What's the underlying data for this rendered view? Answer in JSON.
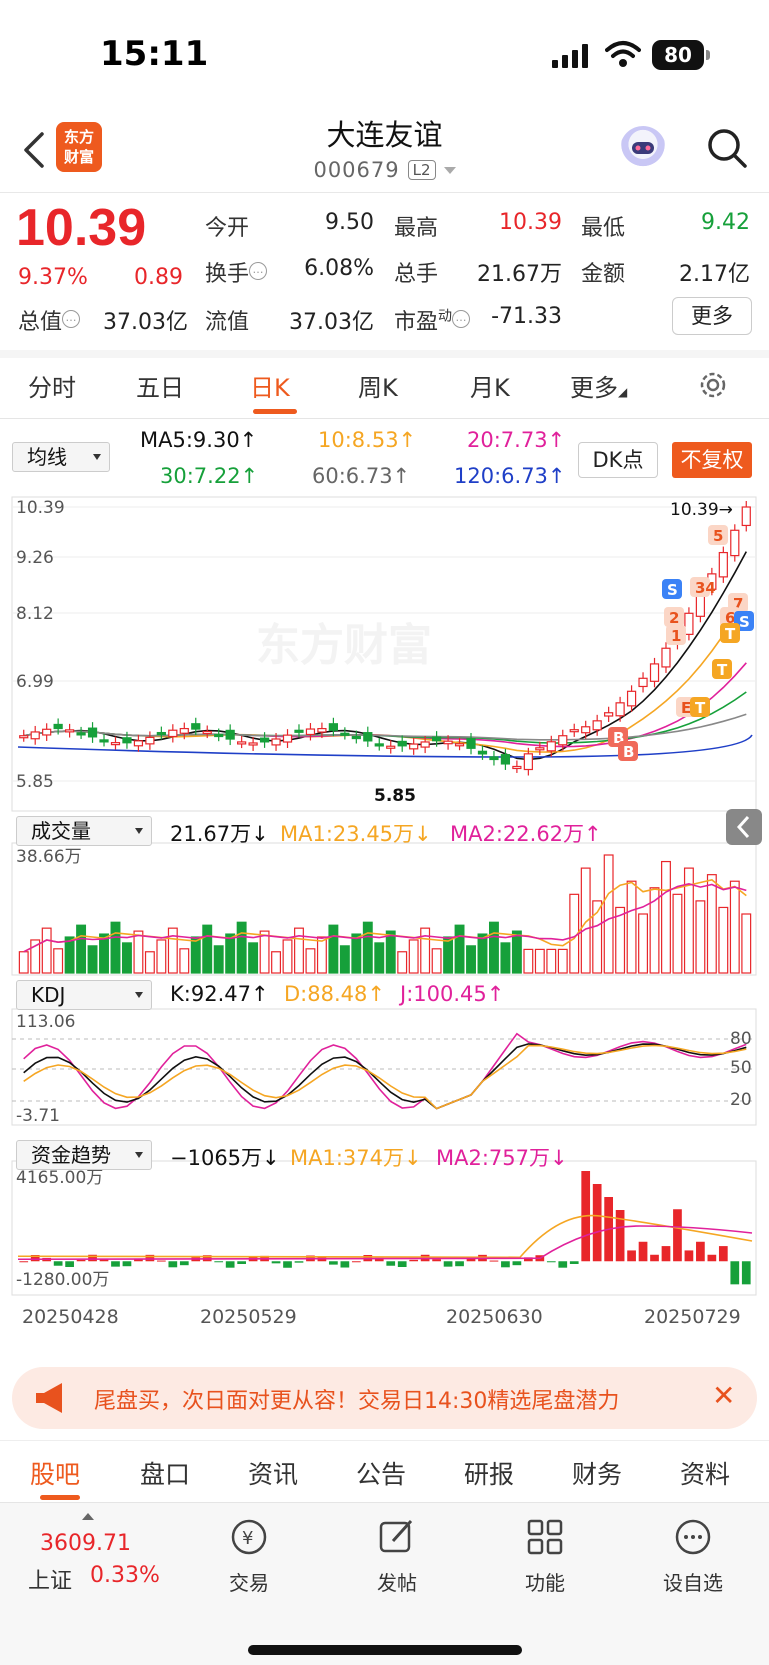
{
  "status_bar": {
    "time": "15:11",
    "battery": "80"
  },
  "header": {
    "logo_text": "东方财富",
    "stock_name": "大连友谊",
    "stock_code": "000679",
    "level": "L2"
  },
  "quote": {
    "price": "10.39",
    "change_pct": "9.37%",
    "change_abs": "0.89",
    "fields": {
      "open_label": "今开",
      "open": "9.50",
      "high_label": "最高",
      "high": "10.39",
      "low_label": "最低",
      "low": "9.42",
      "turnover_label": "换手",
      "turnover": "6.08%",
      "volume_label": "总手",
      "volume": "21.67万",
      "amount_label": "金额",
      "amount": "2.17亿",
      "mktcap_label": "总值",
      "mktcap": "37.03亿",
      "float_label": "流值",
      "float": "37.03亿",
      "pe_label": "市盈",
      "pe_sup": "动",
      "pe": "-71.33"
    },
    "more_label": "更多"
  },
  "period_tabs": [
    "分时",
    "五日",
    "日K",
    "周K",
    "月K",
    "更多"
  ],
  "active_period": "日K",
  "ma_row": {
    "selector": "均线",
    "ma5": "MA5:9.30↑",
    "ma10": "10:8.53↑",
    "ma20": "20:7.73↑",
    "ma30": "30:7.22↑",
    "ma60": "60:6.73↑",
    "ma120": "120:6.73↑",
    "dk_label": "DK点",
    "fq_label": "不复权"
  },
  "colors": {
    "up": "#e8262a",
    "down": "#16a03a",
    "accent": "#ee5a1e",
    "ma5": "#111111",
    "ma10": "#f5a623",
    "ma20": "#e0219b",
    "ma30": "#16a03a",
    "ma60": "#888888",
    "ma120": "#1f3fc7"
  },
  "kline": {
    "y_labels": [
      "10.39",
      "9.26",
      "8.12",
      "6.99",
      "5.85"
    ],
    "max_label": "10.39→",
    "min_label": "5.85",
    "watermark": "东方财富",
    "signal_labels": [
      "5",
      "34",
      "2",
      "1",
      "7",
      "6",
      "S",
      "S",
      "T",
      "T",
      "E",
      "T",
      "B",
      "B"
    ]
  },
  "volume": {
    "selector": "成交量",
    "value": "21.67万↓",
    "ma1": "MA1:23.45万↓",
    "ma2": "MA2:22.62万↑",
    "y_top": "38.66万"
  },
  "kdj": {
    "selector": "KDJ",
    "k": "K:92.47↑",
    "d": "D:88.48↑",
    "j": "J:100.45↑",
    "y_top": "113.06",
    "y_bottom": "-3.71",
    "levels": [
      "80",
      "50",
      "20"
    ]
  },
  "fund_flow": {
    "selector": "资金趋势",
    "value": "−1065万↓",
    "ma1": "MA1:374万↓",
    "ma2": "MA2:757万↓",
    "y_top": "4165.00万",
    "y_bottom": "-1280.00万"
  },
  "x_dates": [
    "20250428",
    "20250529",
    "20250630",
    "20250729"
  ],
  "banner": {
    "text": "尾盘买，次日面对更从容！交易日14:30精选尾盘潜力"
  },
  "content_tabs": [
    "股吧",
    "盘口",
    "资讯",
    "公告",
    "研报",
    "财务",
    "资料"
  ],
  "footer": {
    "index_value": "3609.71",
    "index_name": "上证",
    "index_pct": "0.33%",
    "buttons": [
      {
        "label": "交易",
        "icon": "yen-exchange-icon"
      },
      {
        "label": "发帖",
        "icon": "edit-post-icon"
      },
      {
        "label": "功能",
        "icon": "grid-apps-icon"
      },
      {
        "label": "设自选",
        "icon": "more-circle-icon"
      }
    ]
  }
}
